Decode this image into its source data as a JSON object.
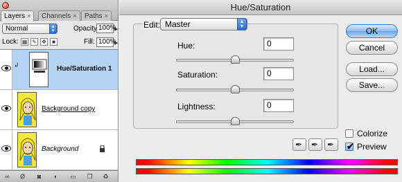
{
  "layers_panel": {
    "tabs": [
      "Layers",
      "Channels",
      "Paths"
    ],
    "tab_close_glyph": "×",
    "blend_mode": "Normal",
    "opacity_label": "Opacity:",
    "opacity_value": "100%",
    "lock_label": "Lock:",
    "fill_label": "Fill:",
    "fill_value": "100%",
    "layers": [
      {
        "name": "Hue/Saturation 1",
        "selected": true,
        "kind": "adjustment"
      },
      {
        "name": "Background copy",
        "selected": false,
        "kind": "image"
      },
      {
        "name": "Background",
        "selected": false,
        "kind": "image-locked"
      }
    ],
    "bottom_icons": [
      "link-icon",
      "layer-style-icon",
      "mask-icon",
      "adjustment-icon",
      "group-icon",
      "new-layer-icon",
      "trash-icon"
    ]
  },
  "dialog": {
    "title": "Hue/Saturation",
    "edit_label": "Edit:",
    "edit_value": "Master",
    "sliders": [
      {
        "label": "Hue:",
        "value": "0",
        "level": 0.5
      },
      {
        "label": "Saturation:",
        "value": "0",
        "level": 0.5
      },
      {
        "label": "Lightness:",
        "value": "0",
        "level": 0.5
      }
    ],
    "buttons": {
      "ok": "OK",
      "cancel": "Cancel",
      "load": "Load...",
      "save": "Save..."
    },
    "colorize_label": "Colorize",
    "colorize_checked": false,
    "preview_label": "Preview",
    "preview_checked": true,
    "check_glyph": "✔"
  }
}
